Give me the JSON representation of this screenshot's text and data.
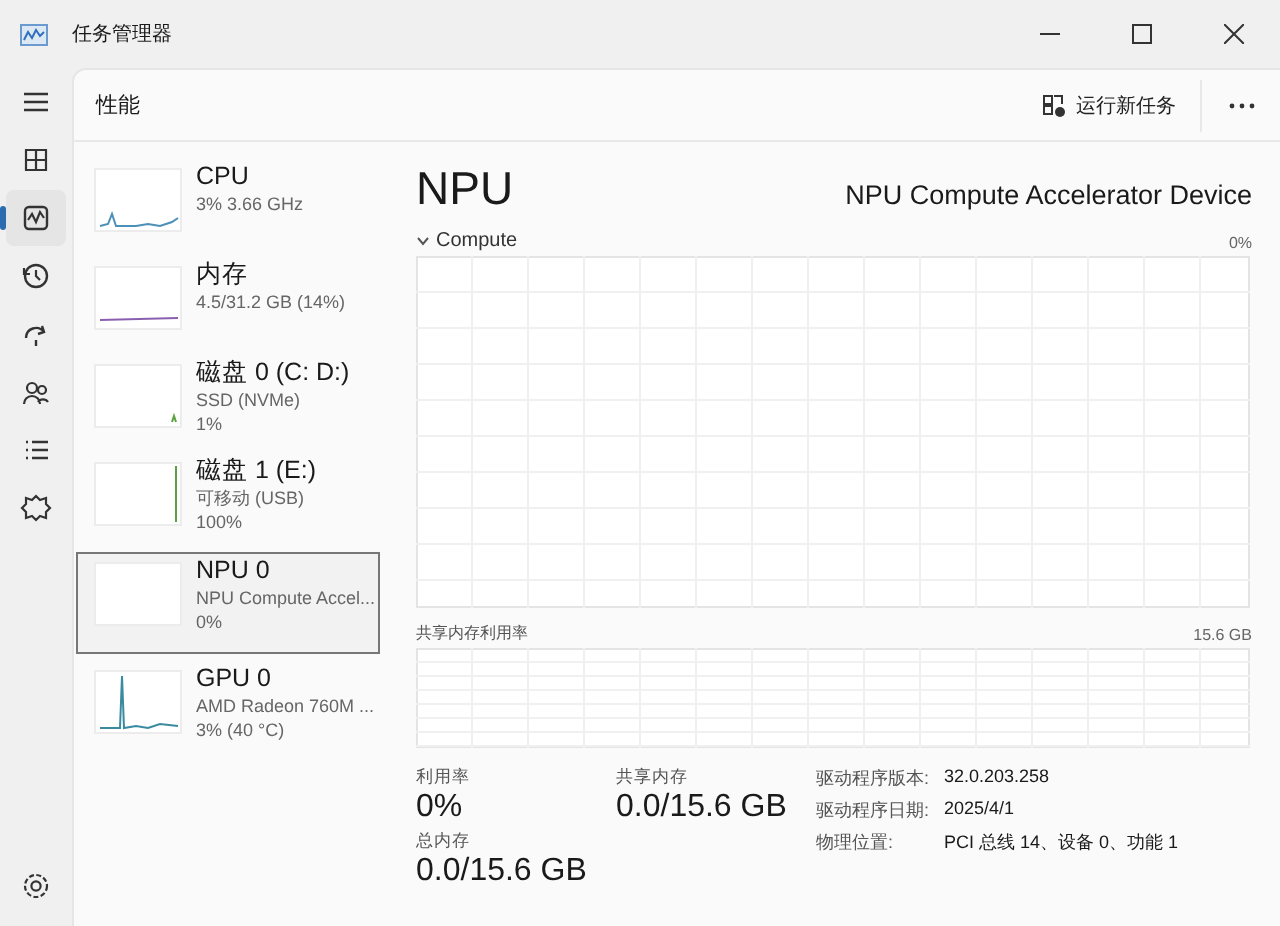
{
  "window": {
    "title": "任务管理器"
  },
  "nav": {
    "items": [
      {
        "kind": "menu",
        "selected": false
      },
      {
        "kind": "processes",
        "selected": false
      },
      {
        "kind": "performance",
        "selected": true
      },
      {
        "kind": "history",
        "selected": false
      },
      {
        "kind": "startup",
        "selected": false
      },
      {
        "kind": "users",
        "selected": false
      },
      {
        "kind": "details",
        "selected": false
      },
      {
        "kind": "services",
        "selected": false
      }
    ]
  },
  "header": {
    "title": "性能",
    "run_task": "运行新任务"
  },
  "devices": [
    {
      "kind": "cpu",
      "name": "CPU",
      "lines": [
        "3%  3.66 GHz"
      ],
      "selected": false
    },
    {
      "kind": "memory",
      "name": "内存",
      "lines": [
        "4.5/31.2 GB (14%)"
      ],
      "selected": false
    },
    {
      "kind": "disk0",
      "name": "磁盘 0 (C: D:)",
      "lines": [
        "SSD (NVMe)",
        "1%"
      ],
      "selected": false
    },
    {
      "kind": "disk1",
      "name": "磁盘 1 (E:)",
      "lines": [
        "可移动 (USB)",
        "100%"
      ],
      "selected": false
    },
    {
      "kind": "npu",
      "name": "NPU 0",
      "lines": [
        "NPU Compute Accel...",
        "0%"
      ],
      "selected": true
    },
    {
      "kind": "gpu",
      "name": "GPU 0",
      "lines": [
        "AMD Radeon 760M ...",
        "3%  (40 °C)"
      ],
      "selected": false
    }
  ],
  "detail": {
    "title": "NPU",
    "device": "NPU Compute Accelerator Device",
    "graphs": [
      {
        "label": "Compute",
        "max": "0%",
        "expanded": true
      },
      {
        "label": "共享内存利用率",
        "max": "15.6 GB"
      }
    ],
    "stats": [
      {
        "label": "利用率",
        "value": "0%"
      },
      {
        "label": "共享内存",
        "value": "0.0/15.6 GB"
      },
      {
        "label": "总内存",
        "value": "0.0/15.6 GB"
      }
    ],
    "info": [
      {
        "key": "驱动程序版本:",
        "value": "32.0.203.258"
      },
      {
        "key": "驱动程序日期:",
        "value": "2025/4/1"
      },
      {
        "key": "物理位置:",
        "value": "PCI 总线 14、设备 0、功能 1"
      }
    ]
  }
}
